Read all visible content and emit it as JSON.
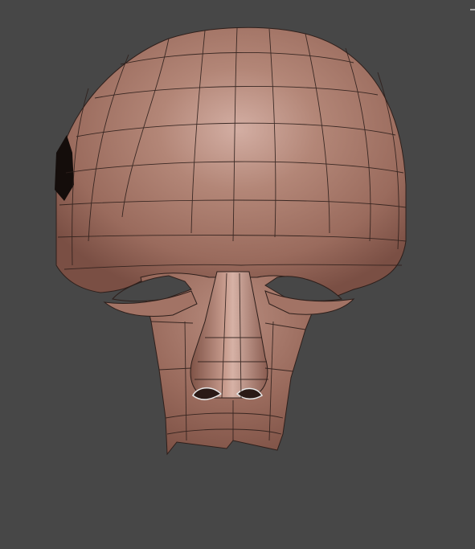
{
  "viewport": {
    "background": "#474747"
  },
  "model": {
    "skin_color": "#a9786b",
    "skin_highlight": "#d3aea3",
    "skin_shadow": "#7a4f44",
    "wire_color": "#2e1f1b",
    "cavity_color": "#140d0b",
    "nostril_shine": "#e7e7e7"
  }
}
